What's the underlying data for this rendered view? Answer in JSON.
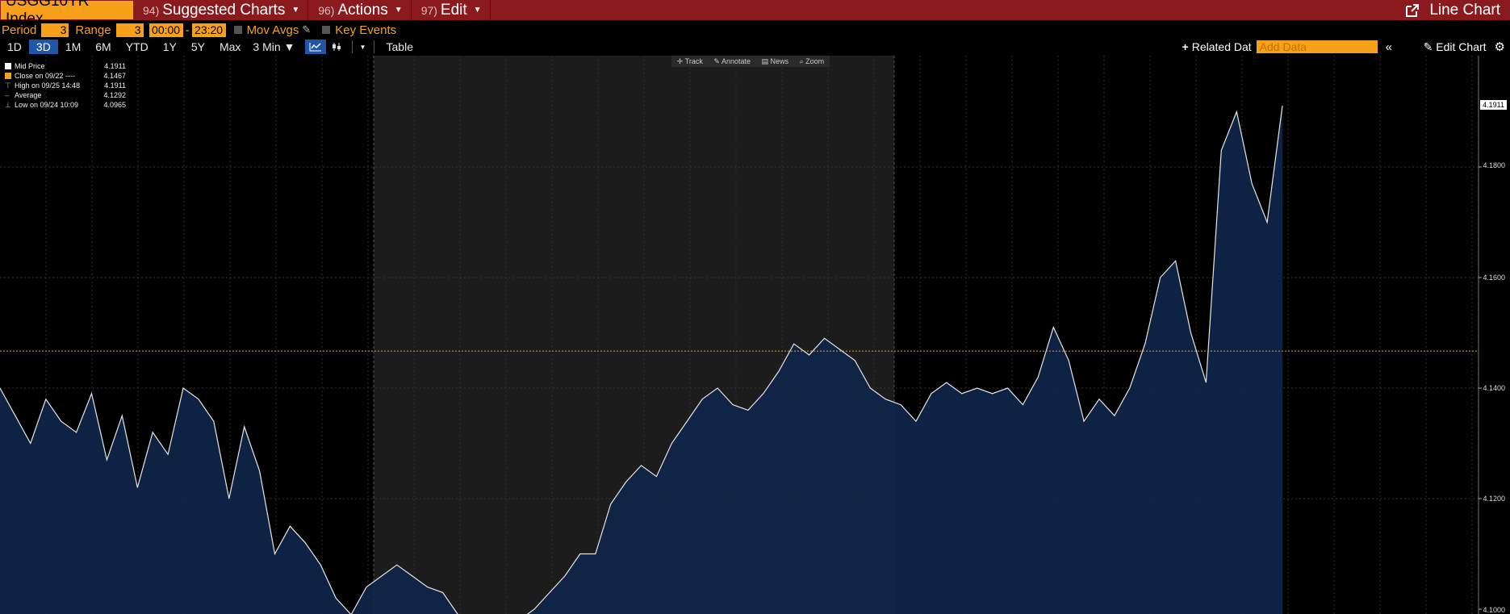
{
  "header": {
    "ticker": "USGG10YR Index",
    "menu": [
      {
        "num": "94)",
        "label": "Suggested Charts"
      },
      {
        "num": "96)",
        "label": "Actions"
      },
      {
        "num": "97)",
        "label": "Edit"
      }
    ],
    "chart_type": "Line Chart"
  },
  "settings": {
    "period_label": "Period",
    "period_value": "3",
    "range_label": "Range",
    "range_value": "3",
    "time_start": "00:00",
    "time_end": "23:20",
    "mov_avgs_label": "Mov Avgs",
    "key_events_label": "Key Events"
  },
  "toolbar": {
    "periods": [
      "1D",
      "3D",
      "1M",
      "6M",
      "YTD",
      "1Y",
      "5Y",
      "Max"
    ],
    "selected_period": "3D",
    "interval": "3 Min",
    "table_label": "Table",
    "related_data_label": "Related Dat",
    "add_data_placeholder": "Add Data",
    "edit_chart_label": "Edit Chart"
  },
  "chart_tools": [
    "Track",
    "Annotate",
    "News",
    "Zoom"
  ],
  "legend": [
    {
      "label": "Mid Price",
      "value": "4.1911",
      "marker": "#ffffff"
    },
    {
      "label": "Close on 09/22 ----",
      "value": "4.1467",
      "marker": "#f7a11a"
    },
    {
      "label": "High on 09/25 14:48",
      "value": "4.1911",
      "marker": "high"
    },
    {
      "label": "Average",
      "value": "4.1292",
      "marker": "avg"
    },
    {
      "label": "Low on 09/24 10:09",
      "value": "4.0965",
      "marker": "low"
    }
  ],
  "last_value": "4.1911",
  "colors": {
    "header_bg": "#8b1a1f",
    "accent": "#f7a11a",
    "line": "#e6e6e6",
    "fill": "#10264a",
    "close_line": "#f7a11a",
    "session_bg": "#1c1c1c"
  },
  "chart_data": {
    "type": "area",
    "y_ticks": [
      "4.1000",
      "4.1200",
      "4.1400",
      "4.1600",
      "4.1800"
    ],
    "ylim": [
      4.1,
      4.1916
    ],
    "reference_line": 4.1467,
    "sessions": [
      "pre",
      "day",
      "post"
    ],
    "series": [
      {
        "values": [
          4.14,
          4.135,
          4.13,
          4.138,
          4.134,
          4.132,
          4.139,
          4.127,
          4.135,
          4.122,
          4.132,
          4.128,
          4.14,
          4.138,
          4.134,
          4.12,
          4.133,
          4.125,
          4.11,
          4.115,
          4.112,
          4.108,
          4.102,
          4.099,
          4.104,
          4.106,
          4.108,
          4.106,
          4.104,
          4.103,
          4.099,
          4.097,
          4.096,
          4.099,
          4.098,
          4.1,
          4.103,
          4.106,
          4.11,
          4.11,
          4.119,
          4.123,
          4.126,
          4.124,
          4.13,
          4.134,
          4.138,
          4.14,
          4.137,
          4.136,
          4.139,
          4.143,
          4.148,
          4.146,
          4.149,
          4.147,
          4.145,
          4.14,
          4.138,
          4.137,
          4.134,
          4.139,
          4.141,
          4.139,
          4.14,
          4.139,
          4.14,
          4.137,
          4.142,
          4.151,
          4.145,
          4.134,
          4.138,
          4.135,
          4.14,
          4.148,
          4.16,
          4.163,
          4.15,
          4.141,
          4.183,
          4.19,
          4.177,
          4.17,
          4.1911
        ]
      }
    ]
  }
}
